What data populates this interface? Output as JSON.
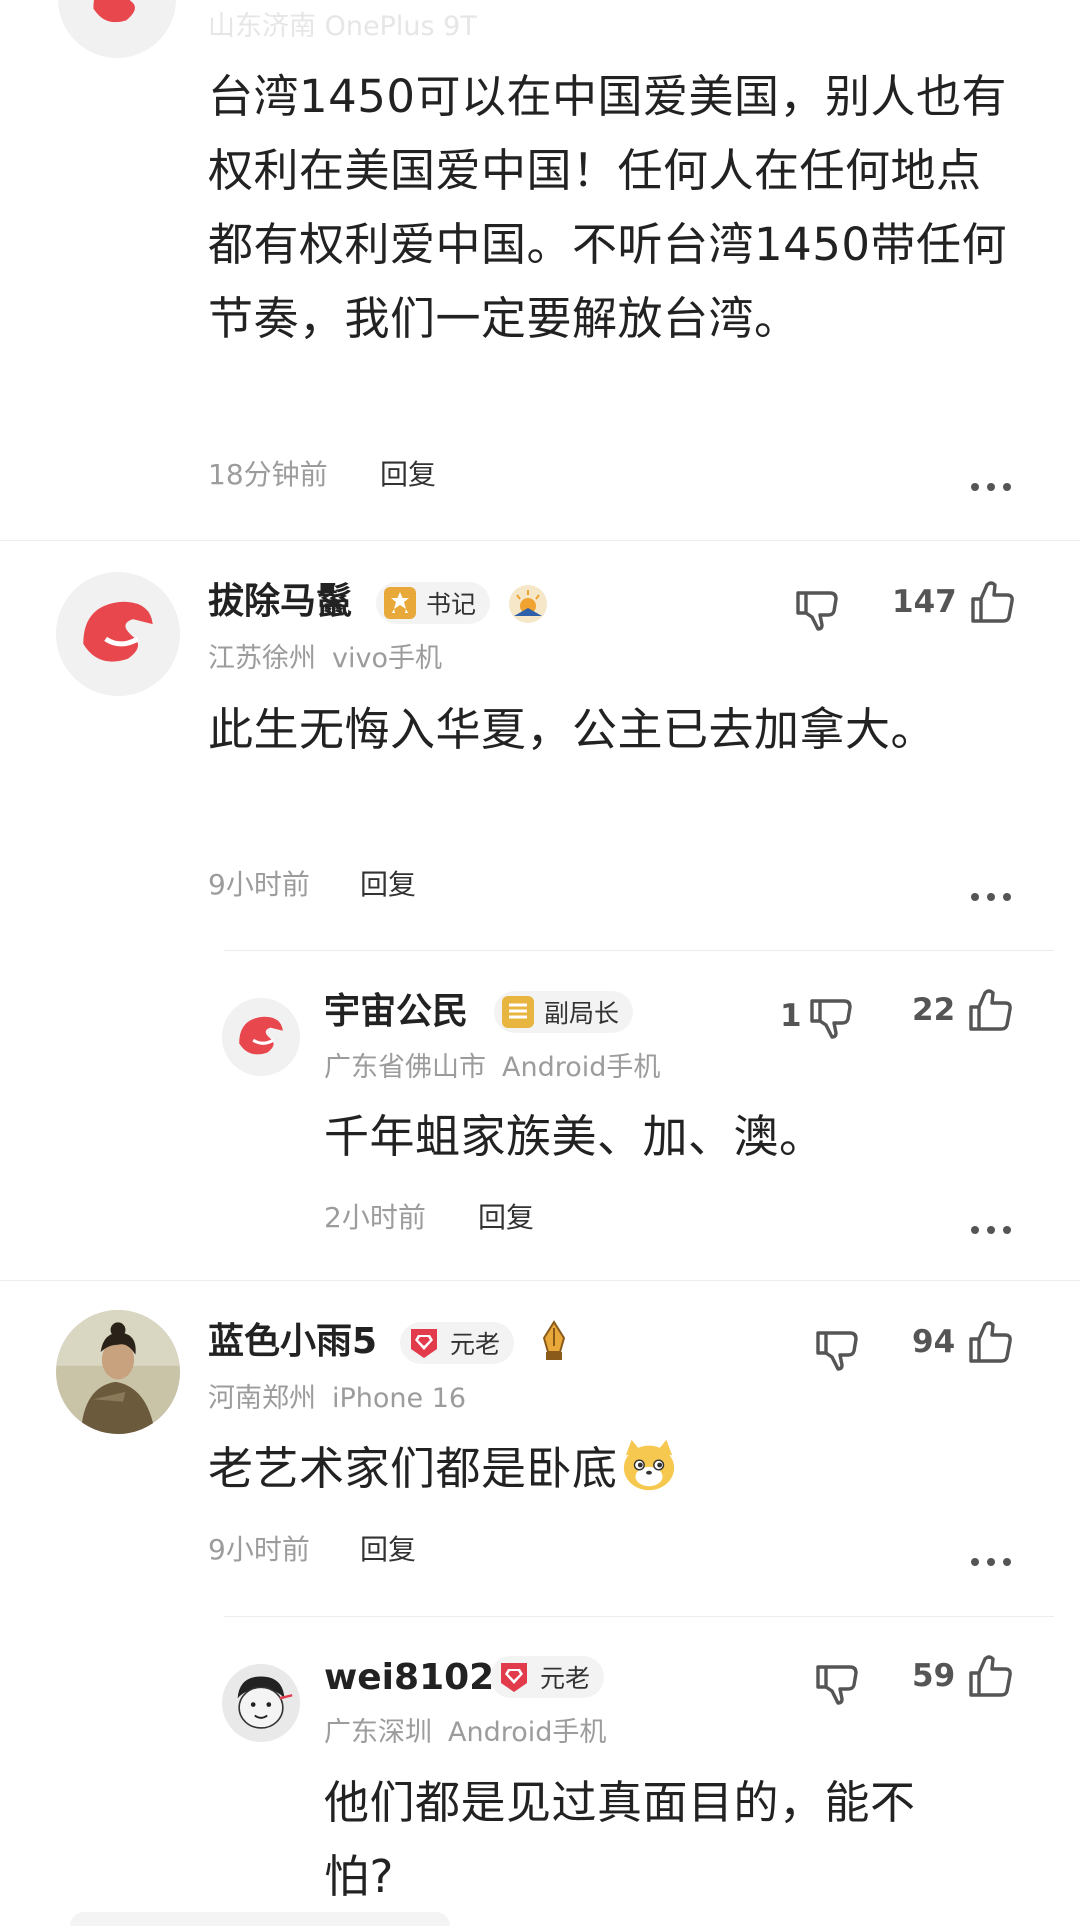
{
  "top_comment": {
    "meta_partial": "山东济南  OnePlus 9T",
    "content": "台湾1450可以在中国爱美国，别人也有权利在美国爱中国！任何人在任何地点都有权利爱中国。不听台湾1450带任何节奏，我们一定要解放台湾。",
    "time": "18分钟前",
    "reply_label": "回复"
  },
  "comments": [
    {
      "username": "拔除马鬣",
      "badge_label": "书记",
      "location": "江苏徐州",
      "device": "vivo手机",
      "content": "此生无悔入华夏，公主已去加拿大。",
      "time": "9小时前",
      "reply_label": "回复",
      "dislike_count": "",
      "like_count": "147",
      "reply": {
        "username": "宇宙公民",
        "badge_label": "副局长",
        "location": "广东省佛山市",
        "device": "Android手机",
        "content": "千年蛆家族美、加、澳。",
        "time": "2小时前",
        "reply_label": "回复",
        "dislike_count": "1",
        "like_count": "22"
      }
    },
    {
      "username": "蓝色小雨5",
      "badge_label": "元老",
      "location": "河南郑州",
      "device": "iPhone 16",
      "content": "老艺术家们都是卧底",
      "time": "9小时前",
      "reply_label": "回复",
      "dislike_count": "",
      "like_count": "94",
      "reply": {
        "username": "wei8102",
        "badge_label": "元老",
        "location": "广东深圳",
        "device": "Android手机",
        "content": "他们都是见过真面目的，能不怕?",
        "dislike_count": "",
        "like_count": "59"
      }
    }
  ],
  "colors": {
    "brand_red": "#e8474e",
    "gold_badge": "#e8a93a",
    "red_badge": "#e23b4b",
    "meta_gray": "#9c9c9c"
  },
  "icons": {
    "like": "thumbs-up-icon",
    "dislike": "thumbs-down-icon",
    "more": "more-dots-icon"
  }
}
